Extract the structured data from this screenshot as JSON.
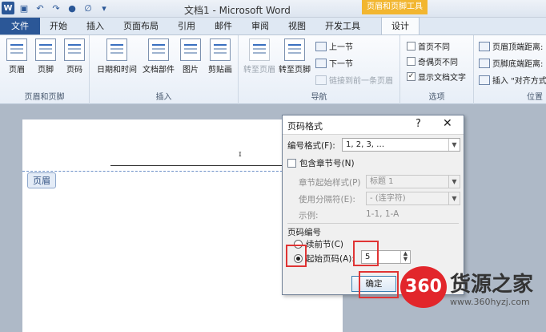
{
  "titlebar": {
    "title": "文档1 - Microsoft Word",
    "context_tab": "页眉和页脚工具",
    "word_icon": "W",
    "qat_icons": [
      "save-icon",
      "undo-icon",
      "redo-icon",
      "color-icon",
      "clear-icon",
      "customize-icon"
    ]
  },
  "tabs": [
    "文件",
    "开始",
    "插入",
    "页面布局",
    "引用",
    "邮件",
    "审阅",
    "视图",
    "开发工具",
    "设计"
  ],
  "ribbon": {
    "group1": {
      "label": "页眉和页脚",
      "buttons": [
        "页眉",
        "页脚",
        "页码"
      ]
    },
    "group2": {
      "label": "插入",
      "buttons": [
        "日期和时间",
        "文档部件",
        "图片",
        "剪贴画"
      ]
    },
    "group3": {
      "label": "导航",
      "buttons": [
        "转至页眉",
        "转至页脚"
      ],
      "small": [
        "上一节",
        "下一节",
        "链接到前一条页眉"
      ]
    },
    "group4": {
      "label": "选项",
      "checks": [
        {
          "label": "首页不同",
          "checked": false
        },
        {
          "label": "奇偶页不同",
          "checked": false
        },
        {
          "label": "显示文档文字",
          "checked": true
        }
      ]
    },
    "group5": {
      "label": "位置",
      "items": [
        "页眉顶端距离:",
        "页脚底端距离:",
        "插入 \"对齐方式"
      ]
    }
  },
  "document": {
    "header_tag": "页眉",
    "cursor_mark": "ɪ"
  },
  "dialog": {
    "title": "页码格式",
    "help": "?",
    "close": "✕",
    "number_format_label": "编号格式(F):",
    "number_format_value": "1, 2, 3, …",
    "include_chapter_label": "包含章节号(N)",
    "chapter_style_label": "章节起始样式(P)",
    "chapter_style_value": "标题 1",
    "separator_label": "使用分隔符(E):",
    "separator_value": "-  (连字符)",
    "example_label": "示例:",
    "example_value": "1-1, 1-A",
    "page_numbering_label": "页码编号",
    "continue_label": "续前节(C)",
    "start_at_label": "起始页码(A):",
    "start_at_value": "5",
    "ok_label": "确定",
    "selected_option": "start_at"
  },
  "watermark": {
    "badge": "360",
    "text": "货源之家",
    "url": "www.360hyzj.com"
  },
  "colors": {
    "accent": "#2b5797",
    "highlight": "#e03434",
    "context_tab": "#f2b630"
  }
}
